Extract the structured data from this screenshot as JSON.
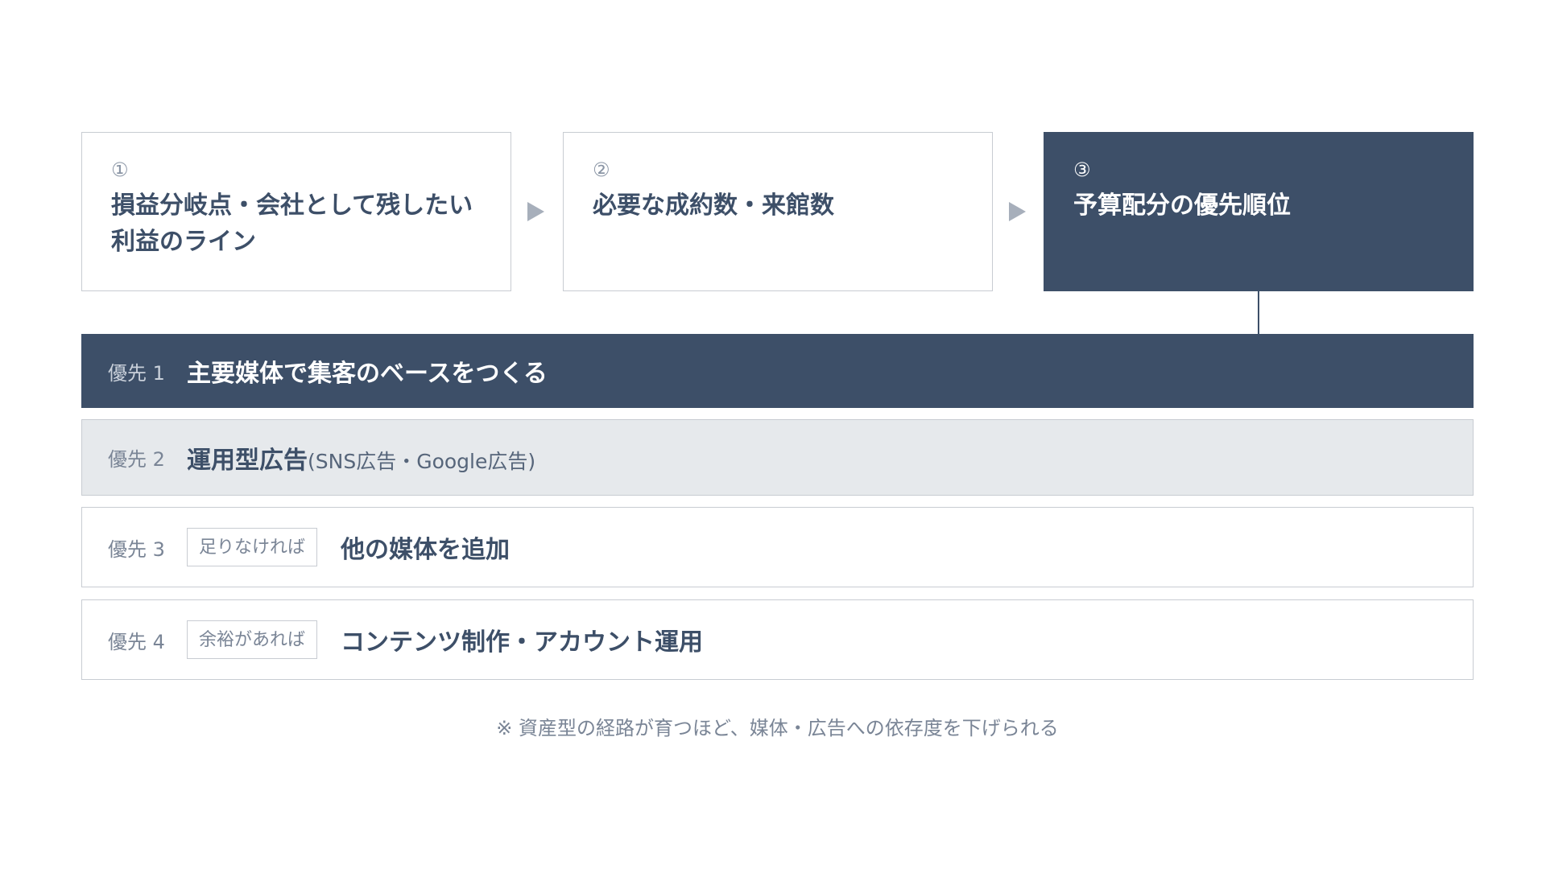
{
  "steps": [
    {
      "number": "①",
      "title": "損益分岐点・会社として残したい利益のライン"
    },
    {
      "number": "②",
      "title": "必要な成約数・来館数"
    },
    {
      "number": "③",
      "title": "予算配分の優先順位"
    }
  ],
  "priorities": [
    {
      "label": "優先 1",
      "title": "主要媒体で集客のベースをつくる"
    },
    {
      "label": "優先 2",
      "title": "運用型広告",
      "subtitle": "(SNS広告・Google広告)"
    },
    {
      "label": "優先 3",
      "tag": "足りなければ",
      "title": "他の媒体を追加"
    },
    {
      "label": "優先 4",
      "tag": "余裕があれば",
      "title": "コンテンツ制作・アカウント運用"
    }
  ],
  "note": "※ 資産型の経路が育つほど、媒体・広告への依存度を下げられる",
  "colors": {
    "navy": "#3d4f68",
    "light_gray_fill": "#e6e9ec",
    "border": "#c8ccd2",
    "arrow": "#a7afbb"
  }
}
